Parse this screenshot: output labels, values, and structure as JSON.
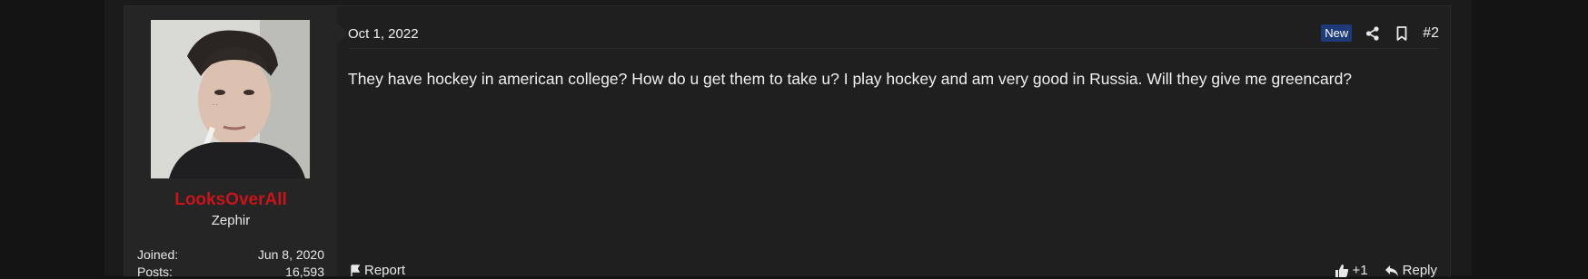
{
  "post": {
    "date": "Oct 1, 2022",
    "badge": "New",
    "number": "#2",
    "body": "They have hockey in american college? How do u get them to take u? I play hockey and am very good in Russia. Will they give me greencard?",
    "icons": {
      "share": "share-icon",
      "bookmark": "bookmark-icon"
    }
  },
  "user": {
    "name": "LooksOverAll",
    "title": "Zephir",
    "stats": [
      {
        "label": "Joined:",
        "value": "Jun 8, 2020"
      },
      {
        "label": "Posts:",
        "value": "16,593"
      }
    ],
    "name_color": "#c8141a"
  },
  "actions": {
    "report": "Report",
    "reaction_count": "+1",
    "reply": "Reply"
  }
}
